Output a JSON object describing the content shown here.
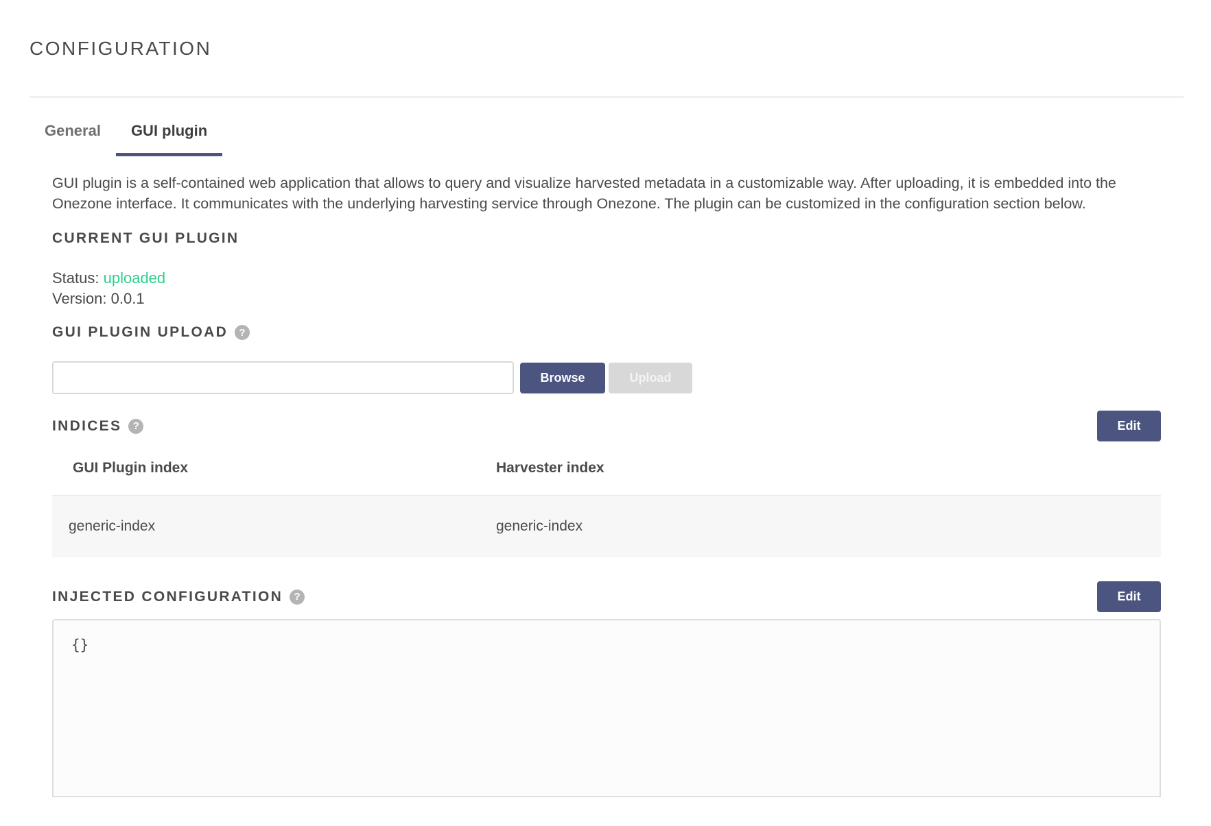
{
  "page": {
    "title": "CONFIGURATION"
  },
  "tabs": [
    {
      "label": "General",
      "active": false
    },
    {
      "label": "GUI plugin",
      "active": true
    }
  ],
  "description": "GUI plugin is a self-contained web application that allows to query and visualize harvested metadata in a customizable way. After uploading, it is embedded into the Onezone interface. It communicates with the underlying harvesting service through Onezone. The plugin can be customized in the configuration section below.",
  "current_plugin": {
    "title": "CURRENT GUI PLUGIN",
    "status_label": "Status:",
    "status_value": "uploaded",
    "version_label": "Version:",
    "version_value": "0.0.1"
  },
  "upload": {
    "title": "GUI PLUGIN UPLOAD",
    "help_icon": "?",
    "file_value": "",
    "browse_label": "Browse",
    "upload_label": "Upload"
  },
  "indices": {
    "title": "INDICES",
    "help_icon": "?",
    "edit_label": "Edit",
    "columns": [
      "GUI Plugin index",
      "Harvester index"
    ],
    "rows": [
      [
        "generic-index",
        "generic-index"
      ]
    ]
  },
  "injected_config": {
    "title": "INJECTED CONFIGURATION",
    "help_icon": "?",
    "edit_label": "Edit",
    "value": "{}"
  },
  "colors": {
    "accent": "#4b5580",
    "status_ok": "#2ecf8c",
    "disabled": "#d8d8d8",
    "row_bg": "#f7f7f7"
  }
}
